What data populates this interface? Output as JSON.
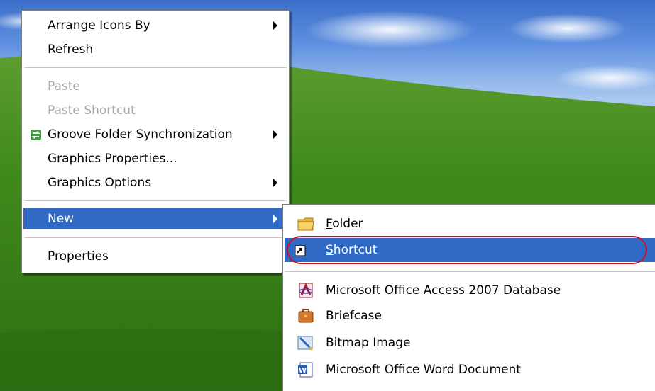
{
  "context_menu": {
    "items": [
      {
        "label": "Arrange Icons By",
        "has_submenu": true
      },
      {
        "label": "Refresh"
      },
      {
        "label": "Paste",
        "disabled": true
      },
      {
        "label": "Paste Shortcut",
        "disabled": true
      },
      {
        "label": "Groove Folder Synchronization",
        "has_submenu": true,
        "icon": "groove-icon"
      },
      {
        "label": "Graphics Properties..."
      },
      {
        "label": "Graphics Options",
        "has_submenu": true
      },
      {
        "label": "New",
        "has_submenu": true,
        "highlighted": true
      },
      {
        "label": "Properties"
      }
    ]
  },
  "new_submenu": {
    "items": [
      {
        "label_first": "F",
        "label_rest": "older",
        "icon": "folder-icon"
      },
      {
        "label_first": "S",
        "label_rest": "hortcut",
        "icon": "shortcut-icon",
        "highlighted": true
      },
      {
        "label": "Microsoft Office Access 2007 Database",
        "icon": "access-icon"
      },
      {
        "label": "Briefcase",
        "icon": "briefcase-icon"
      },
      {
        "label": "Bitmap Image",
        "icon": "bitmap-icon"
      },
      {
        "label": "Microsoft Office Word Document",
        "icon": "word-icon"
      }
    ]
  },
  "colors": {
    "highlight": "#316ac5",
    "annotation_ring": "#c8102e",
    "disabled_text": "#a9a9a9"
  }
}
